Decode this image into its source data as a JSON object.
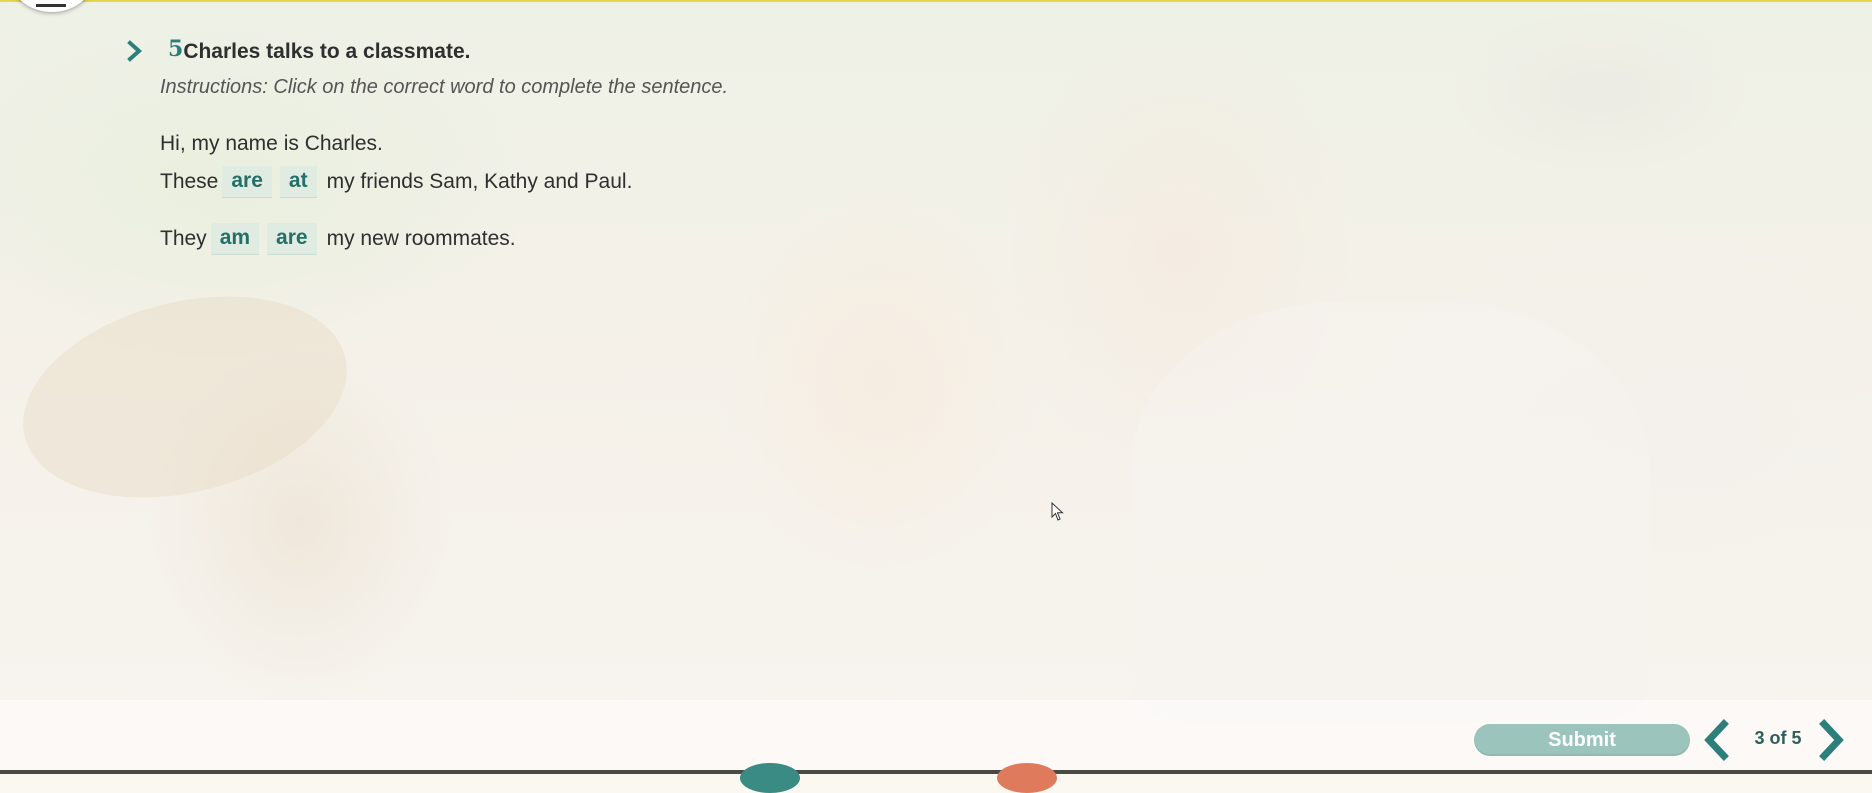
{
  "question": {
    "number": "5",
    "title": "Charles talks to a classmate.",
    "instructions": "Instructions: Click on the correct word to complete the sentence.",
    "lines": [
      {
        "text": "Hi, my name is Charles."
      },
      {
        "before": "These",
        "choices": [
          "are",
          "at"
        ],
        "after": "my friends Sam, Kathy and Paul."
      },
      {
        "before": "They",
        "choices": [
          "am",
          "are"
        ],
        "after": "my new roommates."
      }
    ]
  },
  "footer": {
    "submit_label": "Submit",
    "page_indicator": "3 of 5",
    "prev_icon": "chevron-left-icon",
    "next_icon": "chevron-right-icon"
  },
  "colors": {
    "accent": "#2d7f7b",
    "choice_background": "#deebe2",
    "submit_background": "#9ac4bc",
    "top_line": "#e6d64a"
  }
}
